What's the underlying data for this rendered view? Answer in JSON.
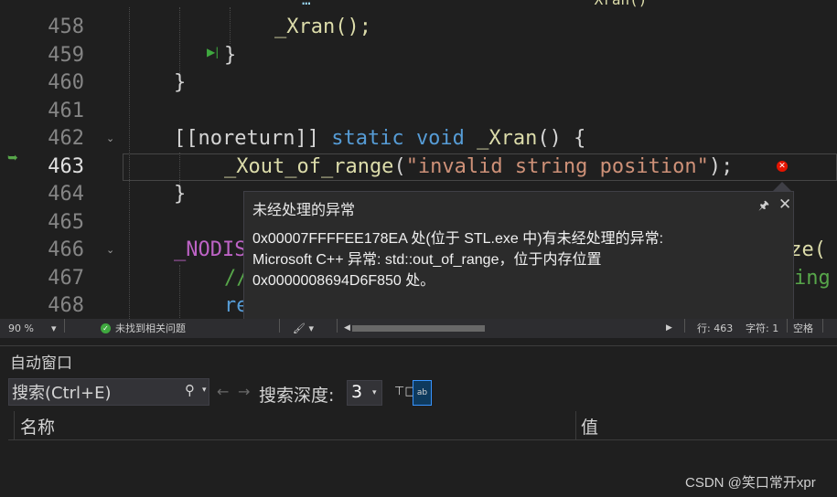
{
  "editor": {
    "top_fragments": [
      "…",
      "_Xran()"
    ],
    "lines": [
      {
        "num": "458",
        "text": "_Xran();"
      },
      {
        "num": "459",
        "text": "}"
      },
      {
        "num": "460",
        "text": "}"
      },
      {
        "num": "461",
        "text": ""
      },
      {
        "num": "462",
        "text": "[[noreturn]] static void _Xran() {"
      },
      {
        "num": "463",
        "text": "_Xout_of_range(\"invalid string position\");"
      },
      {
        "num": "464",
        "text": "}"
      },
      {
        "num": "465",
        "text": ""
      },
      {
        "num": "466",
        "text": "_NODIS",
        "tail": "ize("
      },
      {
        "num": "467",
        "text": "//",
        "tail": "ing"
      },
      {
        "num": "468",
        "text": "re"
      }
    ],
    "tokens": {
      "l462_attr": "[[noreturn]]",
      "l462_static": "static",
      "l462_void": "void",
      "l462_fn": "_Xran",
      "l462_rest": "() {",
      "l463_fn": "_Xout_of_range",
      "l463_open": "(",
      "l463_str": "\"invalid string position\"",
      "l463_close": ");"
    },
    "current_line": "463",
    "icons": {
      "current_statement": "arrow-icon",
      "error": "error-icon",
      "breakpoint": "bookmark-icon"
    },
    "colors": {
      "keyword": "#569cd6",
      "function": "#dcdcaa",
      "string": "#ce9178",
      "error": "#e51400"
    }
  },
  "exception_popup": {
    "title": "未经处理的异常",
    "message_lines": [
      "0x00007FFFFEE178EA 处(位于 STL.exe 中)有未经处理的异常:",
      "Microsoft C++ 异常: std::out_of_range，位于内存位置",
      "0x0000008694D6F850 处。"
    ],
    "pin_icon": "pin-icon",
    "close_icon": "close-icon"
  },
  "status_bar": {
    "zoom": "90 %",
    "issues": "未找到相关问题",
    "line": "行: 463",
    "char": "字符: 1",
    "spacing": "空格"
  },
  "autos": {
    "title": "自动窗口",
    "search_placeholder": "搜索(Ctrl+E)",
    "search_value": "搜索(Ctrl+E)",
    "depth_label": "搜索深度:",
    "depth_value": "3",
    "columns": [
      "名称",
      "值"
    ]
  },
  "watermark": "CSDN @笑口常开xpr"
}
